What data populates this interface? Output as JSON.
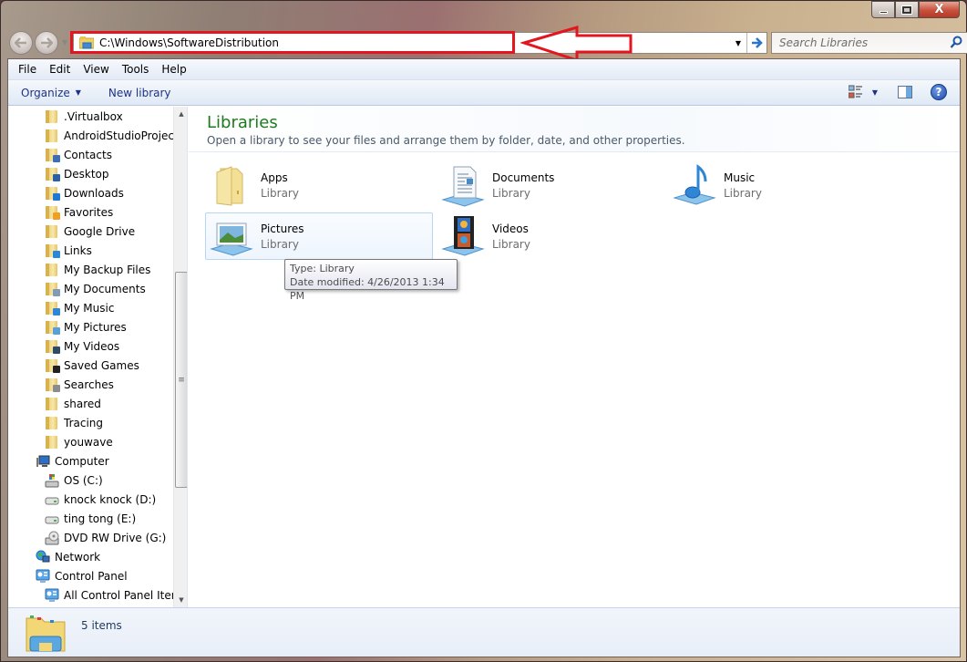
{
  "window": {
    "caption_buttons": {
      "minimize": "minimize",
      "maximize": "maximize",
      "close": "close"
    }
  },
  "nav": {
    "back_icon": "back-arrow-icon",
    "forward_icon": "forward-arrow-icon",
    "recent_icon": "chevron-down-icon",
    "address_value": "C:\\Windows\\SoftwareDistribution",
    "go_icon": "→",
    "dropdown_icon": "▼",
    "search_placeholder": "Search Libraries"
  },
  "annotation": {
    "highlight_color": "#e4151f",
    "arrow_direction": "left"
  },
  "menubar": {
    "items": [
      "File",
      "Edit",
      "View",
      "Tools",
      "Help"
    ]
  },
  "commandbar": {
    "organize_label": "Organize",
    "new_library_label": "New library",
    "caret": "▼",
    "help_glyph": "?"
  },
  "navpane": {
    "items": [
      {
        "label": ".Virtualbox",
        "icon": "folder",
        "level": 2
      },
      {
        "label": "AndroidStudioProjects",
        "icon": "folder",
        "level": 2
      },
      {
        "label": "Contacts",
        "icon": "folder-contacts",
        "level": 2
      },
      {
        "label": "Desktop",
        "icon": "folder-desktop",
        "level": 2
      },
      {
        "label": "Downloads",
        "icon": "folder-downloads",
        "level": 2
      },
      {
        "label": "Favorites",
        "icon": "folder-favorites",
        "level": 2
      },
      {
        "label": "Google Drive",
        "icon": "folder",
        "level": 2
      },
      {
        "label": "Links",
        "icon": "folder-links",
        "level": 2
      },
      {
        "label": "My Backup Files",
        "icon": "folder",
        "level": 2
      },
      {
        "label": "My Documents",
        "icon": "folder-documents",
        "level": 2
      },
      {
        "label": "My Music",
        "icon": "folder-music",
        "level": 2
      },
      {
        "label": "My Pictures",
        "icon": "folder-pictures",
        "level": 2
      },
      {
        "label": "My Videos",
        "icon": "folder-videos",
        "level": 2
      },
      {
        "label": "Saved Games",
        "icon": "folder-games",
        "level": 2
      },
      {
        "label": "Searches",
        "icon": "folder-searches",
        "level": 2
      },
      {
        "label": "shared",
        "icon": "folder",
        "level": 2
      },
      {
        "label": "Tracing",
        "icon": "folder",
        "level": 2
      },
      {
        "label": "youwave",
        "icon": "folder",
        "level": 2
      },
      {
        "label": "Computer",
        "icon": "computer",
        "level": 1
      },
      {
        "label": "OS (C:)",
        "icon": "drive-os",
        "level": 2
      },
      {
        "label": "knock knock (D:)",
        "icon": "drive",
        "level": 2
      },
      {
        "label": "ting tong (E:)",
        "icon": "drive",
        "level": 2
      },
      {
        "label": "DVD RW Drive (G:)",
        "icon": "dvd-drive",
        "level": 2
      },
      {
        "label": "Network",
        "icon": "network",
        "level": 1
      },
      {
        "label": "Control Panel",
        "icon": "control-panel",
        "level": 1
      },
      {
        "label": "All Control Panel Items",
        "icon": "control-panel",
        "level": 2
      }
    ],
    "scroll_up": "▲",
    "scroll_down": "▼",
    "scroll_grip": "≡"
  },
  "content": {
    "title": "Libraries",
    "subtitle": "Open a library to see your files and arrange them by folder, date, and other properties.",
    "libraries": [
      {
        "name": "Apps",
        "type": "Library",
        "icon": "apps-library-icon"
      },
      {
        "name": "Documents",
        "type": "Library",
        "icon": "documents-library-icon"
      },
      {
        "name": "Music",
        "type": "Library",
        "icon": "music-library-icon"
      },
      {
        "name": "Pictures",
        "type": "Library",
        "icon": "pictures-library-icon",
        "hovered": true
      },
      {
        "name": "Videos",
        "type": "Library",
        "icon": "videos-library-icon"
      }
    ],
    "tooltip": {
      "line1": "Type: Library",
      "line2": "Date modified: 4/26/2013 1:34 PM"
    }
  },
  "details": {
    "count_text": "5 items"
  }
}
